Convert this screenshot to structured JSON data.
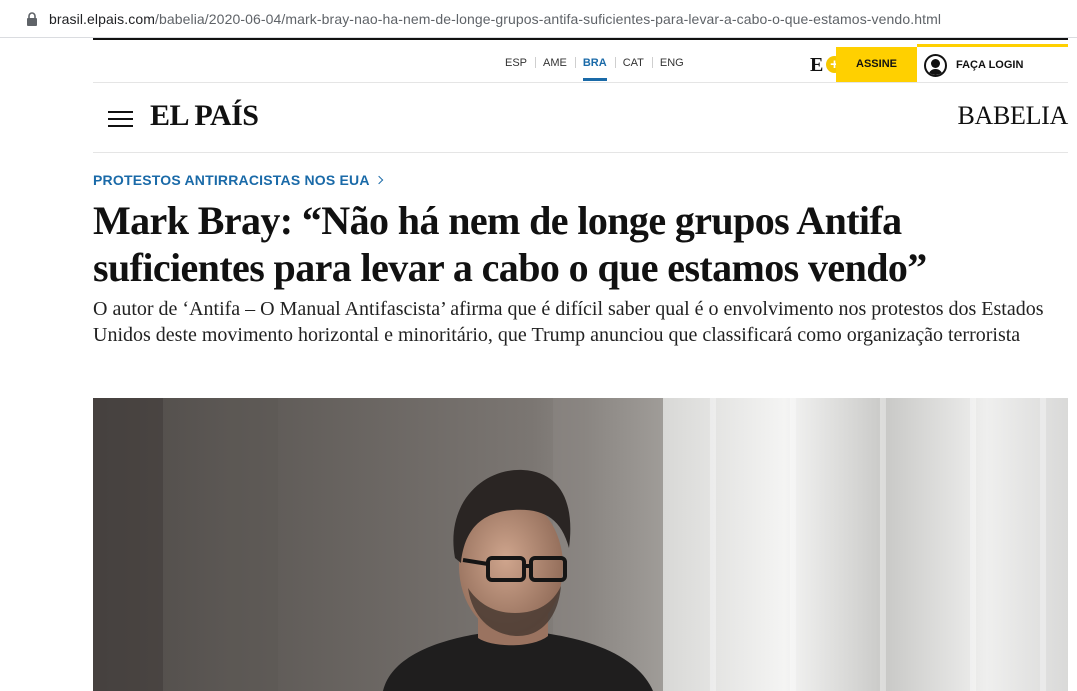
{
  "browser": {
    "url_host": "brasil.elpais.com",
    "url_path": "/babelia/2020-06-04/mark-bray-nao-ha-nem-de-longe-grupos-antifa-suficientes-para-levar-a-cabo-o-que-estamos-vendo.html",
    "lock_icon": "lock-icon"
  },
  "editions": [
    {
      "code": "ESP",
      "active": false
    },
    {
      "code": "AME",
      "active": false
    },
    {
      "code": "BRA",
      "active": true
    },
    {
      "code": "CAT",
      "active": false
    },
    {
      "code": "ENG",
      "active": false
    }
  ],
  "subscribe": {
    "brand_mark": "E",
    "plus": "+",
    "label": "ASSINE"
  },
  "login": {
    "label": "FAÇA LOGIN",
    "icon": "user-icon"
  },
  "masthead": {
    "logo": "EL PAÍS",
    "section": "BABELIA",
    "menu_icon": "hamburger-menu-icon"
  },
  "article": {
    "kicker": "PROTESTOS ANTIRRACISTAS NOS EUA",
    "headline": "Mark Bray: “Não há nem de longe grupos Antifa suficientes para levar a cabo o que estamos vendo”",
    "subhead": "O autor de ‘Antifa – O Manual Antifascista’ afirma que é difícil saber qual é o envolvimento nos protestos dos Estados Unidos deste movimento horizontal e minoritário, que Trump anunciou que classificará como organização terrorista"
  },
  "colors": {
    "accent_blue": "#1a6aa8",
    "subscribe_yellow": "#ffd000",
    "text": "#111111"
  }
}
